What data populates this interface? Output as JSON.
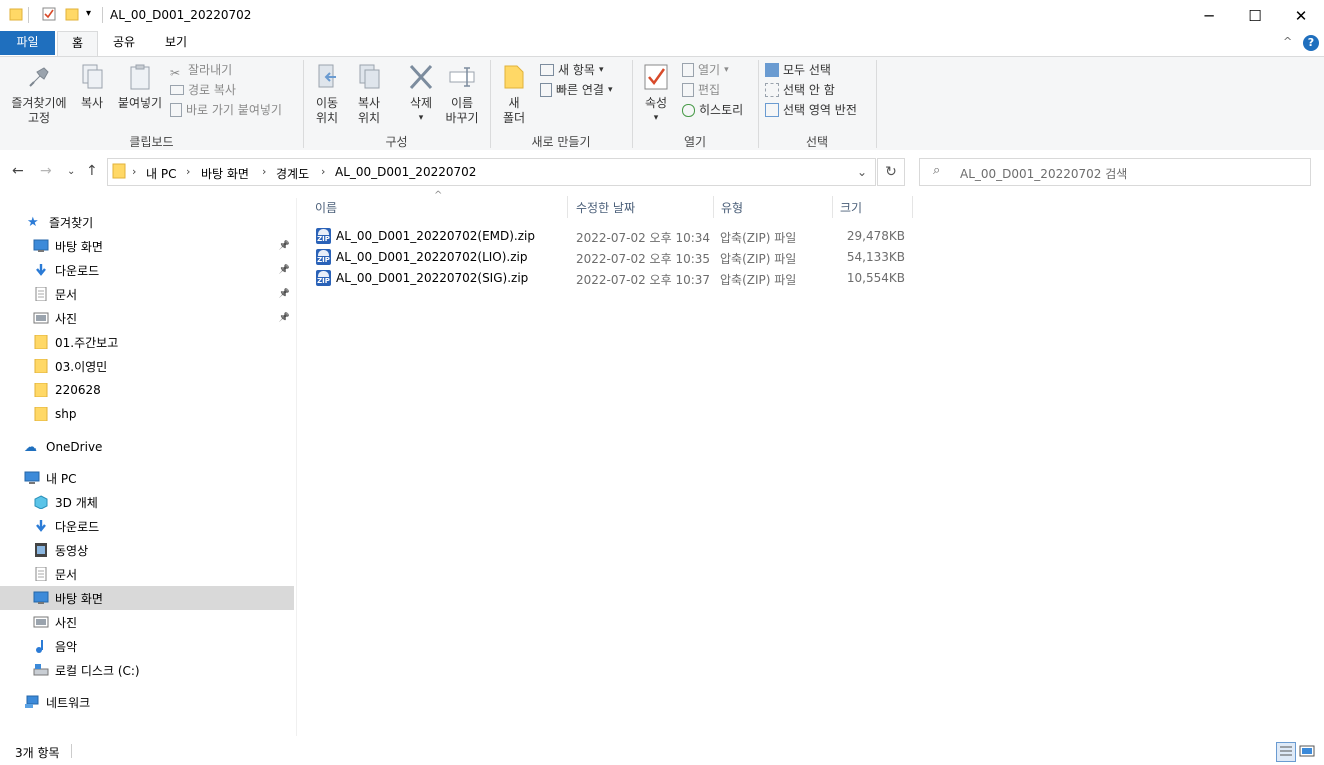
{
  "window": {
    "title": "AL_00_D001_20220702",
    "minimize": "─",
    "maximize": "☐",
    "close": "✕"
  },
  "ribbon_tabs": {
    "file": "파일",
    "home": "홈",
    "share": "공유",
    "view": "보기"
  },
  "ribbon": {
    "clipboard": {
      "pin": "즐겨찾기에\n고정",
      "copy": "복사",
      "paste": "붙여넣기",
      "cut": "잘라내기",
      "copy_path": "경로 복사",
      "paste_shortcut": "바로 가기 붙여넣기",
      "label": "클립보드"
    },
    "organize": {
      "move_to": "이동\n위치",
      "copy_to": "복사\n위치",
      "delete": "삭제",
      "rename": "이름\n바꾸기",
      "label": "구성"
    },
    "new": {
      "new_folder": "새\n폴더",
      "new_item": "새 항목",
      "easy_access": "빠른 연결",
      "label": "새로 만들기"
    },
    "open": {
      "properties": "속성",
      "open": "열기",
      "edit": "편집",
      "history": "히스토리",
      "label": "열기"
    },
    "select": {
      "select_all": "모두 선택",
      "select_none": "선택 안 함",
      "invert": "선택 영역 반전",
      "label": "선택"
    }
  },
  "address": {
    "breadcrumbs": [
      "내 PC",
      "바탕 화면",
      "경계도",
      "AL_00_D001_20220702"
    ],
    "search_placeholder": "AL_00_D001_20220702 검색"
  },
  "nav": {
    "quick_access": "즐겨찾기",
    "quick_items": [
      {
        "label": "바탕 화면",
        "icon": "desktop-icon",
        "pinned": true
      },
      {
        "label": "다운로드",
        "icon": "download-icon",
        "pinned": true
      },
      {
        "label": "문서",
        "icon": "document-icon",
        "pinned": true
      },
      {
        "label": "사진",
        "icon": "pictures-icon",
        "pinned": true
      },
      {
        "label": "01.주간보고",
        "icon": "folder-icon",
        "pinned": false
      },
      {
        "label": "03.이영민",
        "icon": "folder-icon",
        "pinned": false
      },
      {
        "label": "220628",
        "icon": "folder-icon",
        "pinned": false
      },
      {
        "label": "shp",
        "icon": "folder-icon",
        "pinned": false
      }
    ],
    "onedrive": "OneDrive",
    "this_pc": "내 PC",
    "pc_items": [
      {
        "label": "3D 개체",
        "icon": "3d-objects-icon"
      },
      {
        "label": "다운로드",
        "icon": "download-icon"
      },
      {
        "label": "동영상",
        "icon": "videos-icon"
      },
      {
        "label": "문서",
        "icon": "document-icon"
      },
      {
        "label": "바탕 화면",
        "icon": "desktop-icon",
        "selected": true
      },
      {
        "label": "사진",
        "icon": "pictures-icon"
      },
      {
        "label": "음악",
        "icon": "music-icon"
      },
      {
        "label": "로컬 디스크 (C:)",
        "icon": "local-disk-icon"
      }
    ],
    "network": "네트워크"
  },
  "columns": {
    "name": "이름",
    "modified": "수정한 날짜",
    "type": "유형",
    "size": "크기"
  },
  "files": [
    {
      "name": "AL_00_D001_20220702(EMD).zip",
      "modified": "2022-07-02 오후 10:34",
      "type": "압축(ZIP) 파일",
      "size": "29,478KB"
    },
    {
      "name": "AL_00_D001_20220702(LIO).zip",
      "modified": "2022-07-02 오후 10:35",
      "type": "압축(ZIP) 파일",
      "size": "54,133KB"
    },
    {
      "name": "AL_00_D001_20220702(SIG).zip",
      "modified": "2022-07-02 오후 10:37",
      "type": "압축(ZIP) 파일",
      "size": "10,554KB"
    }
  ],
  "status": {
    "item_count": "3개 항목"
  },
  "colors": {
    "accent": "#1f6fbe",
    "selected": "#d9d9d9",
    "folder": "#ffd866"
  }
}
